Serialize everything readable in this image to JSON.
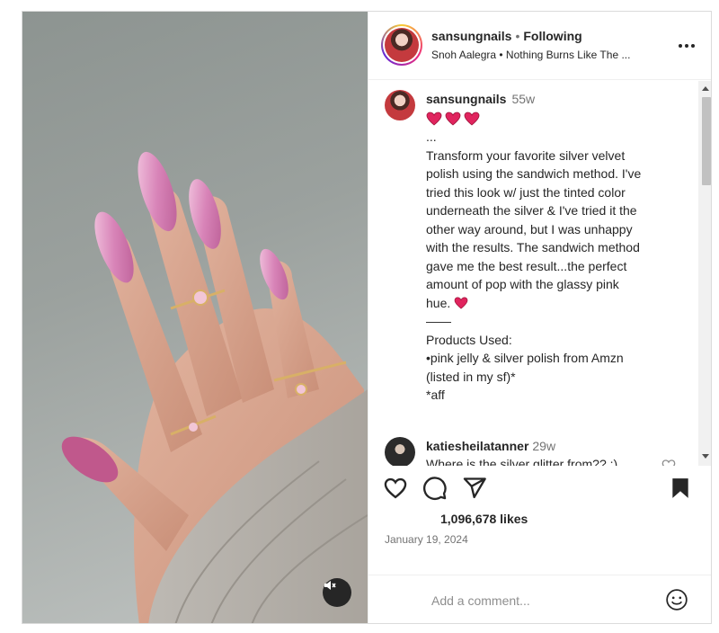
{
  "post": {
    "author": "sansungnails",
    "follow_separator": "•",
    "follow_status": "Following",
    "audio": "Snoh Aalegra • Nothing Burns Like The ..."
  },
  "caption": {
    "author": "sansungnails",
    "time": "55w",
    "lines": [
      "...",
      "Transform your favorite silver velvet",
      "polish using the sandwich method. I've",
      "tried this look w/ just the tinted color",
      "underneath the silver & I've tried it the",
      "other way around, but I was unhappy",
      "with the results. The sandwich method",
      "gave me the best result...the perfect",
      "amount of pop with the glassy pink",
      "hue.",
      "——",
      "Products Used:",
      "•pink jelly & silver polish from Amzn",
      "(listed in my sf)*",
      "*aff"
    ]
  },
  "comment": {
    "author": "katiesheilatanner",
    "time": "29w",
    "text": "Where is the silver glitter from?? :)"
  },
  "stats": {
    "likes": "1,096,678 likes",
    "date": "January 19, 2024"
  },
  "composer": {
    "placeholder": "Add a comment..."
  },
  "icons": {
    "mute": "speaker-muted-icon",
    "more": "more-options-icon",
    "like": "heart-icon",
    "comment": "comment-bubble-icon",
    "share": "paper-plane-icon",
    "save": "bookmark-filled-icon",
    "emoji": "smiley-icon"
  },
  "colors": {
    "heart_emoji": "#e0245e",
    "muted_text": "#737373",
    "text": "#262626"
  }
}
